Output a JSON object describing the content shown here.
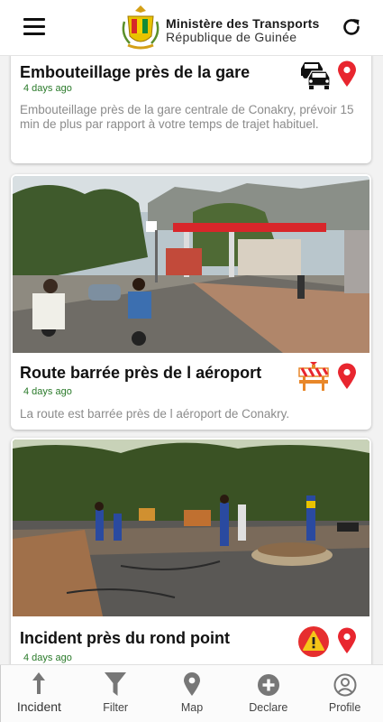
{
  "header": {
    "ministry_line1": "Ministère des Transports",
    "ministry_line2": "République de Guinée",
    "menu_icon": "hamburger-menu-icon",
    "refresh_icon": "refresh-icon",
    "emblem_icon": "guinea-coat-of-arms"
  },
  "incidents": [
    {
      "title": "Embouteillage près de la gare",
      "time": "4 days ago",
      "description": "Embouteillage près de la gare centrale de Conakry, prévoir 15 min de plus par rapport à votre temps de trajet habituel.",
      "type_icon": "traffic-jam-icon",
      "pin_icon": "location-pin-icon"
    },
    {
      "title": "Route barrée près de l aéroport",
      "time": "4 days ago",
      "description": "La route est barrée près de l aéroport de Conakry.",
      "type_icon": "road-barrier-icon",
      "pin_icon": "location-pin-icon"
    },
    {
      "title": "Incident près du rond point",
      "time": "4 days ago",
      "type_icon": "warning-icon",
      "pin_icon": "location-pin-icon"
    }
  ],
  "bottom_nav": [
    {
      "label": "Incident",
      "icon": "arrow-up-icon",
      "active": true
    },
    {
      "label": "Filter",
      "icon": "filter-icon",
      "active": false
    },
    {
      "label": "Map",
      "icon": "map-pin-icon",
      "active": false
    },
    {
      "label": "Declare",
      "icon": "plus-circle-icon",
      "active": false
    },
    {
      "label": "Profile",
      "icon": "user-profile-icon",
      "active": false
    }
  ],
  "colors": {
    "pin_red": "#e8262f",
    "time_green": "#2a7a2a",
    "warning_red": "#e62e2e",
    "warning_yellow": "#f5c518",
    "barrier_orange": "#e8872a"
  }
}
